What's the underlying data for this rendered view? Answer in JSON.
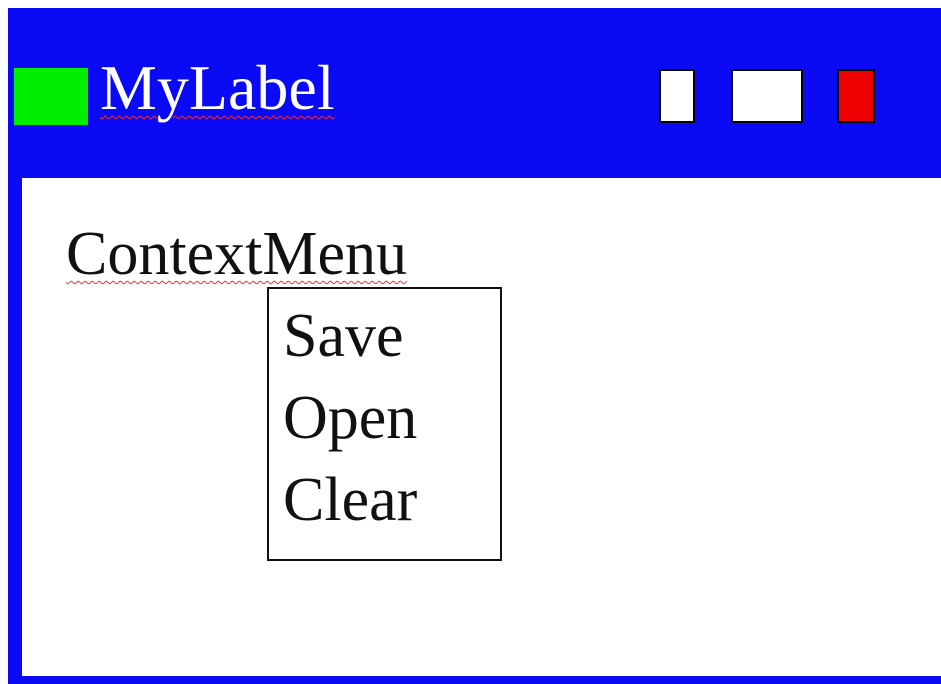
{
  "window": {
    "title": "MyLabel",
    "colors": {
      "titlebar": "#0a0af5",
      "app_icon": "#00ee00",
      "close_button": "#ee0000",
      "minimize_button": "#ffffff",
      "maximize_button": "#ffffff"
    },
    "controls": {
      "minimize_icon": "minimize-icon",
      "maximize_icon": "maximize-icon",
      "close_icon": "close-icon"
    }
  },
  "content": {
    "label": "ContextMenu"
  },
  "context_menu": {
    "items": [
      {
        "label": "Save"
      },
      {
        "label": "Open"
      },
      {
        "label": "Clear"
      }
    ]
  }
}
